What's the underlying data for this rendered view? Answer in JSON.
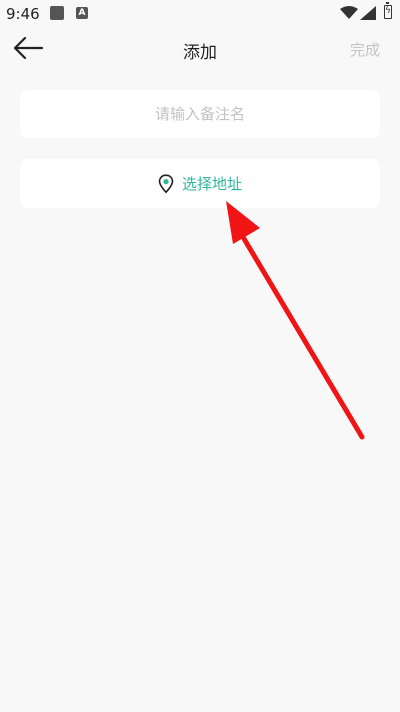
{
  "status_bar": {
    "time": "9:46",
    "notif_a_glyph": "A",
    "icons": [
      "notification-square-icon",
      "accessibility-a-icon",
      "wifi-icon",
      "signal-icon",
      "battery-charging-icon"
    ]
  },
  "header": {
    "title": "添加",
    "done_label": "完成",
    "back_icon": "arrow-left-icon"
  },
  "form": {
    "name_placeholder": "请输入备注名",
    "name_value": "",
    "address_label": "选择地址",
    "address_icon": "location-pin-icon"
  },
  "colors": {
    "background": "#f8f8f8",
    "card": "#ffffff",
    "accent_green": "#2db89a",
    "done_disabled": "#c4c4c4",
    "annotation_red": "#f01414"
  }
}
